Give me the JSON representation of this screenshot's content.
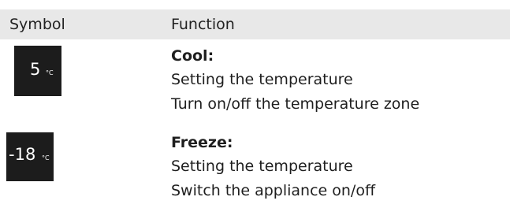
{
  "header": {
    "symbol": "Symbol",
    "function": "Function"
  },
  "rows": [
    {
      "symbol_value": "5",
      "symbol_unit": "°C",
      "title": "Cool:",
      "lines": [
        "Setting the temperature",
        "Turn on/off the temperature zone"
      ]
    },
    {
      "symbol_value": "-18",
      "symbol_unit": "°C",
      "title": "Freeze:",
      "lines": [
        "Setting the temperature",
        "Switch the appliance on/off"
      ]
    }
  ]
}
